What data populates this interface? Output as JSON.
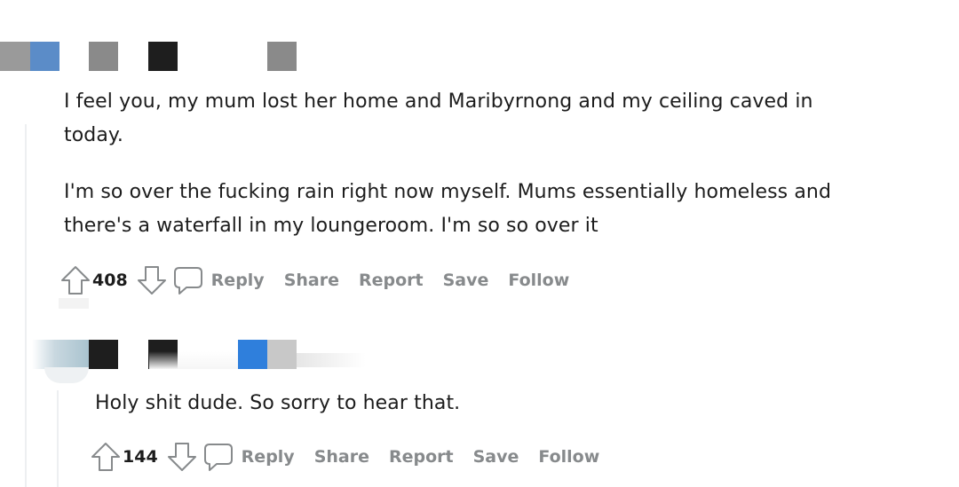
{
  "comments": [
    {
      "paragraphs": [
        "I feel you, my mum lost her home and Maribyrnong and my ceiling caved in today.",
        "I'm so over the fucking rain right now myself. Mums essentially homeless and there's a waterfall in my loungeroom. I'm so so over it"
      ],
      "paragraph_lines": [
        [
          "I feel you, my mum lost her home and Maribyrnong and my ceiling caved in",
          "today."
        ],
        [
          "I'm so over the fucking rain right now myself. Mums essentially homeless and",
          "there's a waterfall in my loungeroom. I'm so so over it"
        ]
      ],
      "vote_count": "408",
      "actions": {
        "reply": "Reply",
        "share": "Share",
        "report": "Report",
        "save": "Save",
        "follow": "Follow"
      }
    },
    {
      "author_meta_visible": "",
      "paragraphs": [
        "Holy shit dude. So sorry to hear that."
      ],
      "vote_count": "144",
      "actions": {
        "reply": "Reply",
        "share": "Share",
        "report": "Report",
        "save": "Save",
        "follow": "Follow"
      }
    }
  ],
  "colors": {
    "text": "#1c1c1c",
    "action_grey": "#878a8c",
    "thread_line": "#edeff1",
    "redact_blue": "#5b8cc8",
    "redact_grey": "#8a8a8a",
    "redact_black": "#1e1e1e"
  },
  "icons": [
    "upvote-arrow-icon",
    "downvote-arrow-icon",
    "comment-bubble-icon"
  ]
}
